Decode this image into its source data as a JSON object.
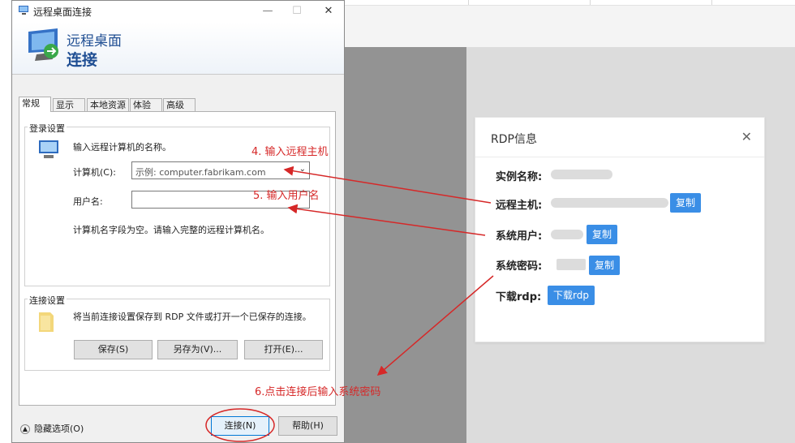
{
  "dialog": {
    "title": "远程桌面连接",
    "banner_line1": "远程桌面",
    "banner_line2": "连接",
    "controls": {
      "minimize": "—",
      "maximize": "☐",
      "close": "✕"
    },
    "tabs": [
      "常规",
      "显示",
      "本地资源",
      "体验",
      "高级"
    ],
    "login_group": {
      "label": "登录设置",
      "instruction": "输入远程计算机的名称。",
      "computer_label": "计算机(C):",
      "computer_placeholder": "示例: computer.fabrikam.com",
      "username_label": "用户名:",
      "username_value": "",
      "hint": "计算机名字段为空。请输入完整的远程计算机名。"
    },
    "connection_group": {
      "label": "连接设置",
      "text": "将当前连接设置保存到 RDP 文件或打开一个已保存的连接。",
      "save": "保存(S)",
      "save_as": "另存为(V)...",
      "open": "打开(E)..."
    },
    "hide_options": "隐藏选项(O)",
    "connect": "连接(N)",
    "help": "帮助(H)"
  },
  "rdp_card": {
    "title": "RDP信息",
    "close": "✕",
    "rows": [
      {
        "label": "实例名称:",
        "button": ""
      },
      {
        "label": "远程主机:",
        "button": "复制"
      },
      {
        "label": "系统用户:",
        "button": "复制"
      },
      {
        "label": "系统密码:",
        "button": "复制"
      },
      {
        "label": "下载rdp:",
        "button": "下载rdp"
      }
    ]
  },
  "annotations": {
    "step4": "4. 输入远程主机",
    "step5": "5. 输入用户名",
    "step6": "6.点击连接后输入系统密码"
  },
  "colors": {
    "annotation": "#d62828",
    "button": "#3a8ee6",
    "banner_text": "#1f4e93"
  }
}
